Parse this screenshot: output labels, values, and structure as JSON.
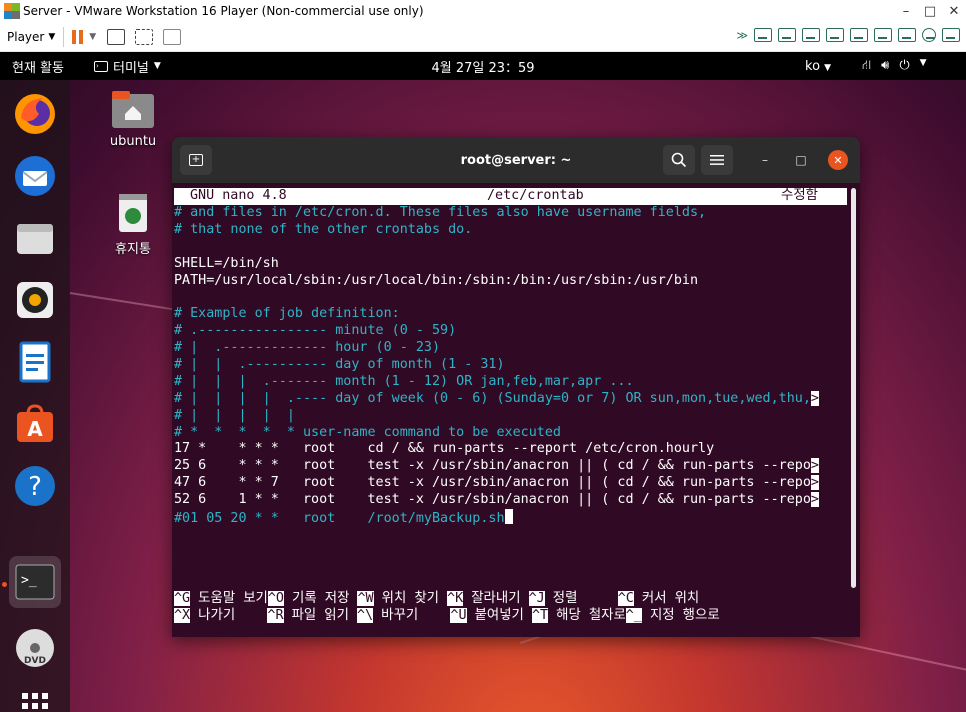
{
  "vmware": {
    "title": "Server - VMware Workstation 16 Player (Non-commercial use only)",
    "minimize": "–",
    "maximize": "□",
    "close": "✕",
    "player_menu": "Player",
    "brand_colors": {
      "pause": "#e66b1a",
      "devices": "#2b6e5e"
    }
  },
  "topbar": {
    "activities": "현재 활동",
    "app_menu": "터미널",
    "clock": "4월 27일  23：59",
    "input_lang": "ko"
  },
  "dock": {
    "items": [
      "firefox-icon",
      "thunderbird-icon",
      "files-icon",
      "rhythmbox-icon",
      "writer-icon",
      "software-icon",
      "help-icon",
      "terminal-icon",
      "dvd-icon",
      "app-grid-icon"
    ]
  },
  "desktop": {
    "icons": [
      {
        "label": "ubuntu",
        "icon": "home-folder-icon"
      },
      {
        "label": "휴지통",
        "icon": "trash-icon"
      }
    ]
  },
  "terminal": {
    "title": "root@server: ~",
    "nano": {
      "version": "GNU nano 4.8",
      "filename": "/etc/crontab",
      "status": "수정함"
    },
    "lines": [
      "# and files in /etc/cron.d. These files also have username fields,",
      "# that none of the other crontabs do.",
      "",
      "SHELL=/bin/sh",
      "PATH=/usr/local/sbin:/usr/local/bin:/sbin:/bin:/usr/sbin:/usr/bin",
      "",
      "# Example of job definition:",
      "# .---------------- minute (0 - 59)",
      "# |  .------------- hour (0 - 23)",
      "# |  |  .---------- day of month (1 - 31)",
      "# |  |  |  .------- month (1 - 12) OR jan,feb,mar,apr ...",
      "# |  |  |  |  .---- day of week (0 - 6) (Sunday=0 or 7) OR sun,mon,tue,wed,thu,",
      "# |  |  |  |  |",
      "# *  *  *  *  * user-name command to be executed",
      "17 *    * * *   root    cd / && run-parts --report /etc/cron.hourly",
      "25 6    * * *   root    test -x /usr/sbin/anacron || ( cd / && run-parts --repo",
      "47 6    * * 7   root    test -x /usr/sbin/anacron || ( cd / && run-parts --repo",
      "52 6    1 * *   root    test -x /usr/sbin/anacron || ( cd / && run-parts --repo",
      "#01 05 20 * *   root    /root/myBackup.sh"
    ],
    "continuation_marker": ">",
    "help_row1": [
      {
        "key": "^G",
        "label": " 도움말 보기"
      },
      {
        "key": "^O",
        "label": " 기록 저장 "
      },
      {
        "key": "^W",
        "label": " 위치 찾기 "
      },
      {
        "key": "^K",
        "label": " 잘라내기 "
      },
      {
        "key": "^J",
        "label": " 정렬     "
      },
      {
        "key": "^C",
        "label": " 커서 위치"
      }
    ],
    "help_row2": [
      {
        "key": "^X",
        "label": " 나가기    "
      },
      {
        "key": "^R",
        "label": " 파일 읽기 "
      },
      {
        "key": "^\\",
        "label": " 바꾸기    "
      },
      {
        "key": "^U",
        "label": " 붙여넣기 "
      },
      {
        "key": "^T",
        "label": " 해당 철자로"
      },
      {
        "key": "^_",
        "label": " 지정 행으로"
      }
    ]
  }
}
